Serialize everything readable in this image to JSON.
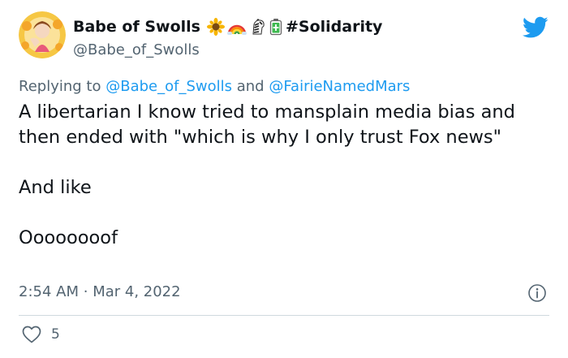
{
  "author": {
    "display_name": "Babe of Swolls",
    "hashtag": "#Solidarity",
    "handle": "@Babe_of_Swolls",
    "name_emojis": [
      "sunflower-emoji",
      "rainbow-emoji",
      "zebra-emoji",
      "battery-emoji"
    ]
  },
  "reply": {
    "prefix": "Replying to",
    "mention_1": "@Babe_of_Swolls",
    "joiner": "and",
    "mention_2": "@FairieNamedMars"
  },
  "tweet": {
    "line_1": "A libertarian I know tried to mansplain media bias and then ended with \"which is why I only trust Fox news\"",
    "line_2": "And like",
    "line_3": "Oooooooof"
  },
  "meta": {
    "time": "2:54 AM",
    "separator": "·",
    "date": "Mar 4, 2022"
  },
  "engagement": {
    "likes": "5"
  },
  "icons": {
    "brand": "twitter-bird-icon",
    "info": "info-icon",
    "like": "heart-icon"
  },
  "colors": {
    "brand_blue": "#1d9bf0",
    "text": "#0f1419",
    "muted": "#536471",
    "divider": "#cfd9de"
  }
}
